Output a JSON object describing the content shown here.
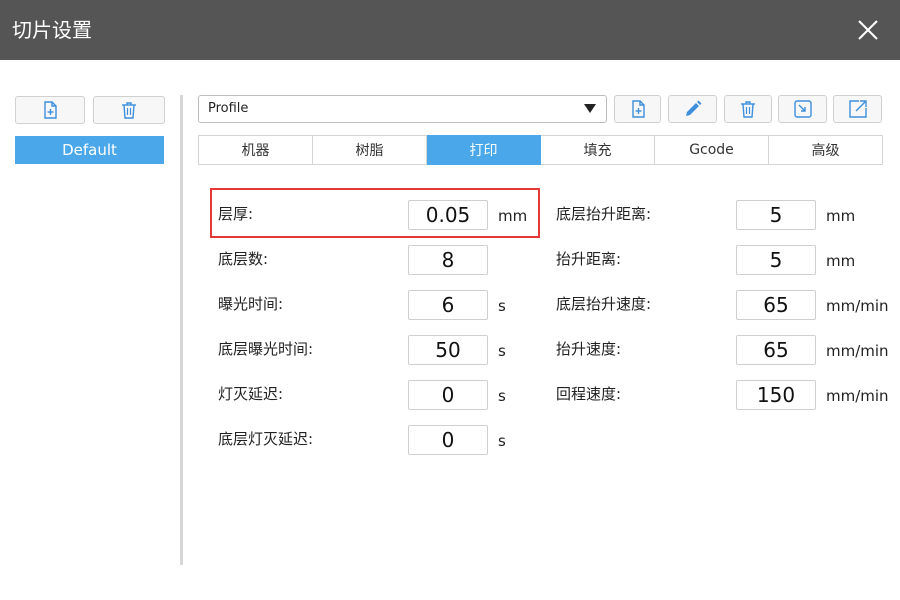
{
  "window": {
    "title": "切片设置",
    "close_icon": "close-icon"
  },
  "sidebar": {
    "items": [
      {
        "label": "Default",
        "selected": true
      }
    ],
    "add_icon": "file-add-icon",
    "delete_icon": "trash-icon",
    "accent": "#4aa8ea"
  },
  "profile": {
    "selected": "Profile"
  },
  "toolbar": {
    "icons": [
      "file-add-icon",
      "pencil-icon",
      "trash-icon",
      "import-icon",
      "export-icon"
    ]
  },
  "tabs": [
    {
      "label": "机器"
    },
    {
      "label": "树脂"
    },
    {
      "label": "打印",
      "active": true
    },
    {
      "label": "填充"
    },
    {
      "label": "Gcode"
    },
    {
      "label": "高级"
    }
  ],
  "settings": {
    "left": [
      {
        "label": "层厚:",
        "value": "0.05",
        "unit": "mm"
      },
      {
        "label": "底层数:",
        "value": "8",
        "unit": ""
      },
      {
        "label": "曝光时间:",
        "value": "6",
        "unit": "s"
      },
      {
        "label": "底层曝光时间:",
        "value": "50",
        "unit": "s"
      },
      {
        "label": "灯灭延迟:",
        "value": "0",
        "unit": "s"
      },
      {
        "label": "底层灯灭延迟:",
        "value": "0",
        "unit": "s"
      }
    ],
    "right": [
      {
        "label": "底层抬升距离:",
        "value": "5",
        "unit": "mm"
      },
      {
        "label": "抬升距离:",
        "value": "5",
        "unit": "mm"
      },
      {
        "label": "底层抬升速度:",
        "value": "65",
        "unit": "mm/min"
      },
      {
        "label": "抬升速度:",
        "value": "65",
        "unit": "mm/min"
      },
      {
        "label": "回程速度:",
        "value": "150",
        "unit": "mm/min"
      }
    ]
  },
  "colors": {
    "titlebar": "#555555",
    "highlight": "#e53935",
    "icon_blue": "#3d8fdb"
  }
}
